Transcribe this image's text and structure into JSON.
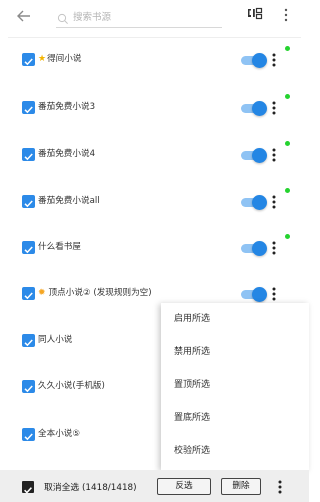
{
  "header": {
    "back_icon": "arrow-left-icon",
    "search_placeholder": "搜索书源",
    "group_icon": "group-icon",
    "more_icon": "more-vert-icon"
  },
  "sources": [
    {
      "label": "得间小说",
      "prefix_icon": "star-icon",
      "enabled": true,
      "has_dot": true
    },
    {
      "label": "番茄免费小说3",
      "enabled": true,
      "has_dot": true
    },
    {
      "label": "番茄免费小说4",
      "enabled": true,
      "has_dot": true
    },
    {
      "label": "番茄免费小说all",
      "enabled": true,
      "has_dot": true
    },
    {
      "label": "什么看书屋",
      "enabled": true,
      "has_dot": true
    },
    {
      "label": "顶点小说② (发现规则为空)",
      "prefix_icon": "sun-icon",
      "enabled": true,
      "has_dot": false
    },
    {
      "label": "同人小说"
    },
    {
      "label": "久久小说(手机版)"
    },
    {
      "label": "全本小说⑤"
    }
  ],
  "context_menu": {
    "items": [
      "启用所选",
      "禁用所选",
      "置顶所选",
      "置底所选",
      "校验所选"
    ]
  },
  "bottom_bar": {
    "select_all_label": "取消全选 (1418/1418)",
    "invert_label": "反选",
    "delete_label": "删除"
  },
  "colors": {
    "accent": "#2c8ae8",
    "switch_on": "#2486e4",
    "dot_green": "#25d32f"
  }
}
